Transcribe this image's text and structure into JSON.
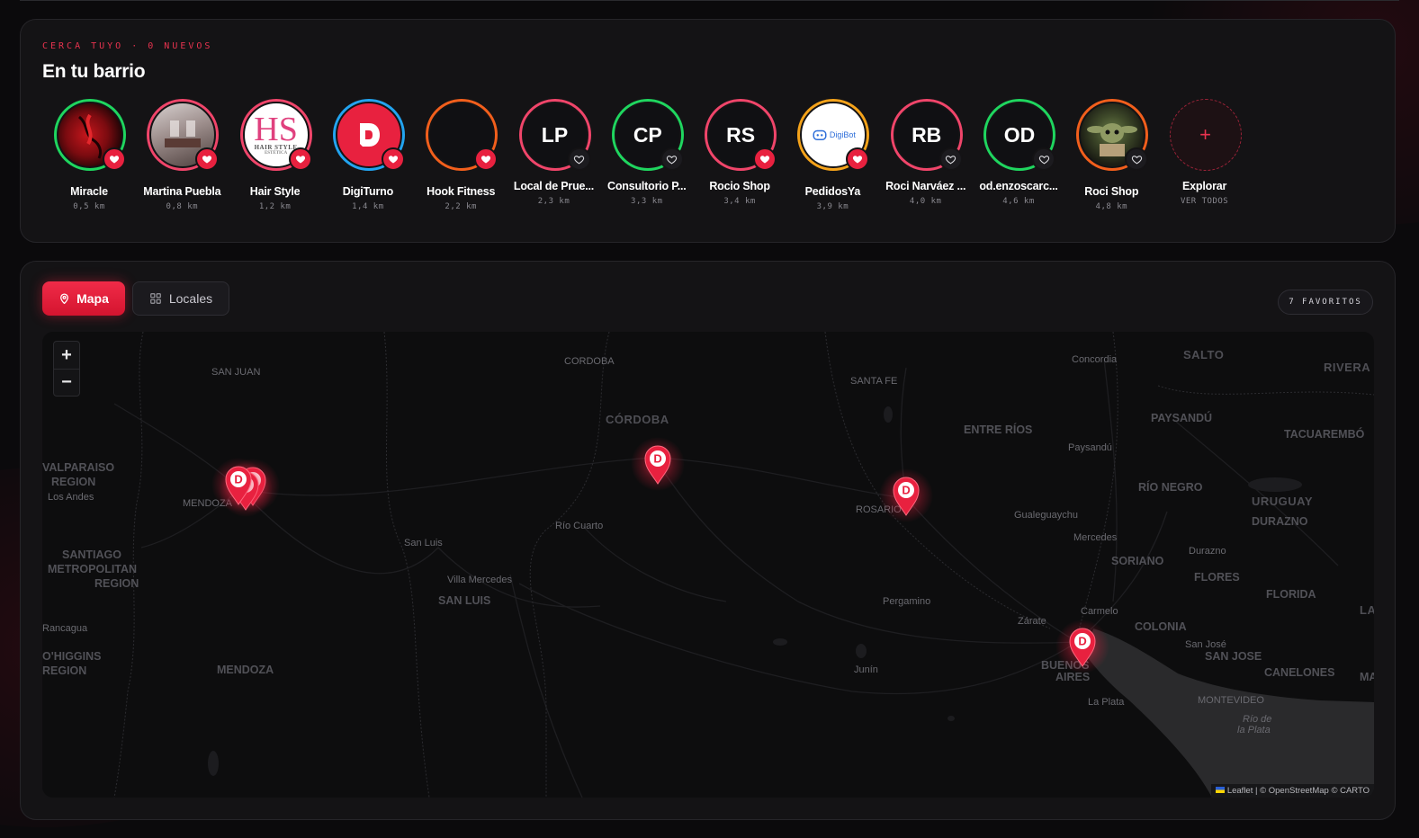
{
  "nearby": {
    "eyebrow": "CERCA TUYO · 0 NUEVOS",
    "title": "En tu barrio",
    "stories": [
      {
        "name": "Miracle",
        "distance": "0,5 km",
        "ring": "#1fd65f",
        "fav": true,
        "initials": "",
        "avatar": "photo-red"
      },
      {
        "name": "Martina Puebla",
        "distance": "0,8 km",
        "ring": "#f0456a",
        "fav": true,
        "initials": "",
        "avatar": "photo-salon"
      },
      {
        "name": "Hair Style",
        "distance": "1,2 km",
        "ring": "#f0456a",
        "fav": true,
        "initials": "HS",
        "avatar": "logo-hs",
        "logo_sub": "HAIR STYLE",
        "logo_sub2": "ESTÉTICA"
      },
      {
        "name": "DigiTurno",
        "distance": "1,4 km",
        "ring": "#22a4f0",
        "fav": true,
        "initials": "D",
        "avatar": "logo-d"
      },
      {
        "name": "Hook Fitness",
        "distance": "2,2 km",
        "ring": "#f25f1c",
        "fav": true,
        "initials": "",
        "avatar": "blank"
      },
      {
        "name": "Local de Prue...",
        "distance": "2,3 km",
        "ring": "#f0456a",
        "fav": false,
        "initials": "LP",
        "avatar": "initials"
      },
      {
        "name": "Consultorio P...",
        "distance": "3,3 km",
        "ring": "#1fd65f",
        "fav": false,
        "initials": "CP",
        "avatar": "initials"
      },
      {
        "name": "Rocio Shop",
        "distance": "3,4 km",
        "ring": "#f0456a",
        "fav": true,
        "initials": "RS",
        "avatar": "initials"
      },
      {
        "name": "PedidosYa",
        "distance": "3,9 km",
        "ring": "#f5a31a",
        "fav": true,
        "initials": "DigiBot",
        "avatar": "logo-digibot"
      },
      {
        "name": "Roci Narváez ...",
        "distance": "4,0 km",
        "ring": "#f0456a",
        "fav": false,
        "initials": "RB",
        "avatar": "initials"
      },
      {
        "name": "od.enzoscarc...",
        "distance": "4,6 km",
        "ring": "#1fd65f",
        "fav": false,
        "initials": "OD",
        "avatar": "initials"
      },
      {
        "name": "Roci Shop",
        "distance": "4,8 km",
        "ring": "#f25f1c",
        "fav": false,
        "initials": "",
        "avatar": "photo-yoda"
      }
    ],
    "explore": {
      "name": "Explorar",
      "sub": "VER TODOS",
      "icon": "+"
    }
  },
  "view": {
    "map_label": "Mapa",
    "locales_label": "Locales",
    "favorites_count": "7 FAVORITOS"
  },
  "map": {
    "zoom_in": "+",
    "zoom_out": "−",
    "attribution": "Leaflet | © OpenStreetMap © CARTO",
    "labels": [
      "SAN JUAN",
      "CORDOBA",
      "SANTA FE",
      "Concordia",
      "SALTO",
      "RIVERA",
      "CÓRDOBA",
      "ENTRE RÍOS",
      "PAYSANDÚ",
      "TACUAREMBÓ",
      "Paysandú",
      "VALPARAISO",
      "REGION",
      "Los Andes",
      "MENDOZA",
      "ROSARIO",
      "URUGUAY",
      "RÍO NEGRO",
      "DURAZNO",
      "Río Cuarto",
      "Gualeguaychu",
      "Mercedes",
      "San Luis",
      "SORIANO",
      "Durazno",
      "SANTIAGO",
      "METROPOLITAN",
      "REGION",
      "FLORES",
      "Villa Mercedes",
      "SAN LUIS",
      "FLORIDA",
      "Pergamino",
      "Carmelo",
      "LAVALLEJA",
      "Rancagua",
      "Zárate",
      "COLONIA",
      "San José",
      "O'HIGGINS",
      "REGION",
      "MENDOZA",
      "Junín",
      "BUENOS",
      "AIRES",
      "SAN JOSE",
      "CANELONES",
      "MALDONADO",
      "La Plata",
      "MONTEVIDEO",
      "Río de",
      "la Plata"
    ],
    "pin_glyph": "D",
    "accent": "#e8213f"
  }
}
